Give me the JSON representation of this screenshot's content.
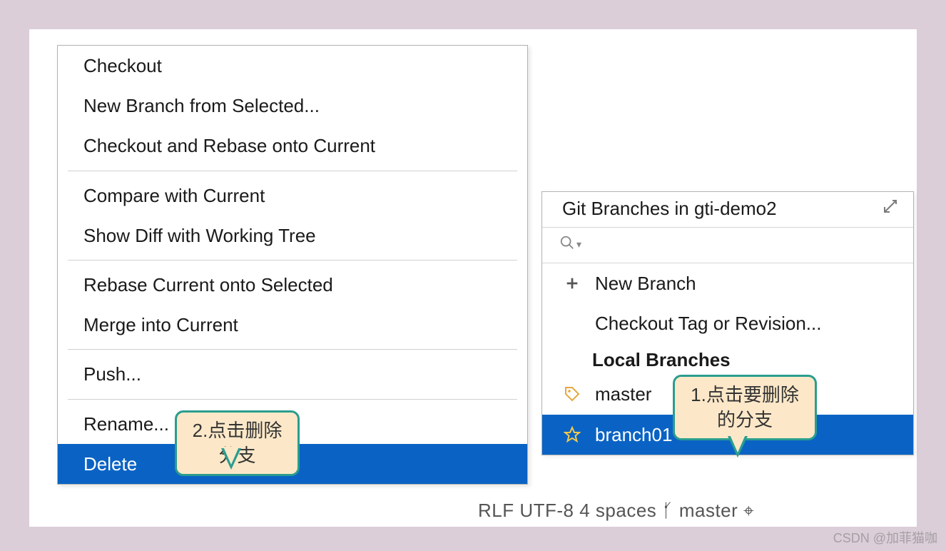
{
  "leftMenu": {
    "groups": [
      [
        {
          "label": "Checkout"
        },
        {
          "label": "New Branch from Selected..."
        },
        {
          "label": "Checkout and Rebase onto Current"
        }
      ],
      [
        {
          "label": "Compare with Current"
        },
        {
          "label": "Show Diff with Working Tree"
        }
      ],
      [
        {
          "label": "Rebase Current onto Selected"
        },
        {
          "label": "Merge into Current"
        }
      ],
      [
        {
          "label": "Push..."
        }
      ],
      [
        {
          "label": "Rename..."
        },
        {
          "label": "Delete",
          "selected": true
        }
      ]
    ]
  },
  "rightPopup": {
    "title": "Git Branches in gti-demo2",
    "searchPlaceholder": "",
    "newBranchLabel": "New Branch",
    "checkoutTagLabel": "Checkout Tag or Revision...",
    "localBranchesLabel": "Local Branches",
    "branches": [
      {
        "name": "master",
        "icon": "tag"
      },
      {
        "name": "branch01",
        "icon": "star",
        "selected": true
      }
    ]
  },
  "statusBar": {
    "text": "RLF   UTF-8   4 spaces   ᚶ master   ⌖"
  },
  "callouts": {
    "c1": "1.点击要删除的分支",
    "c2": "2.点击删除分支"
  },
  "watermark": "CSDN @加菲猫咖"
}
